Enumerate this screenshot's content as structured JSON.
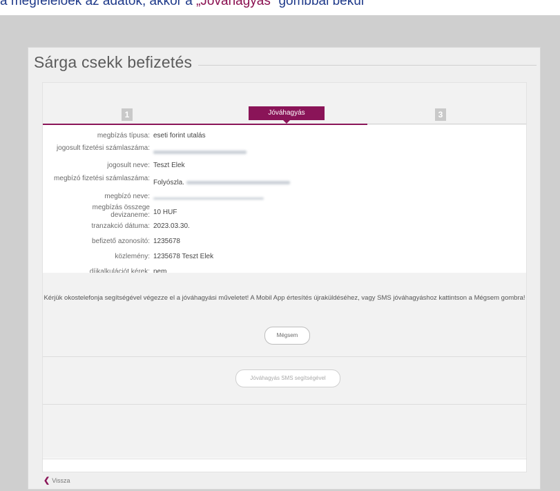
{
  "doc": {
    "pre": "a megfelelőek az adatok, akkor a ",
    "highlight": "„Jóváhagyás”",
    "post": " gombbal bekül"
  },
  "page": {
    "title": "Sárga csekk befizetés"
  },
  "steps": {
    "step1": "1",
    "active": "Jóváhagyás",
    "step3": "3"
  },
  "fields": [
    {
      "label": "megbízás típusa:",
      "value": "eseti forint utalás"
    },
    {
      "label": "jogosult fizetési számlaszáma:",
      "value": ""
    },
    {
      "label": "jogosult neve:",
      "value": "Teszt Elek"
    },
    {
      "label": "megbízó fizetési számlaszáma:",
      "value": "Folyószla."
    },
    {
      "label": "megbízó neve:",
      "value": ""
    },
    {
      "label": "megbízás összege devizaneme:",
      "value": "10 HUF"
    },
    {
      "label": "tranzakció dátuma:",
      "value": "2023.03.30."
    },
    {
      "label": "befizető azonosító:",
      "value": "1235678"
    },
    {
      "label": "közlemény:",
      "value": "1235678 Teszt Elek"
    },
    {
      "label": "díjkalkulációt kérek:",
      "value": "nem"
    }
  ],
  "info": {
    "text": "Kérjük okostelefonja segítségével végezze el a jóváhagyási műveletet! A Mobil App értesítés újraküldéséhez, vagy SMS jóváhagyáshoz kattintson a Mégsem gombra!",
    "cancel_label": "Mégsem",
    "sms_label": "Jóváhagyás SMS segítségével"
  },
  "nav": {
    "back_label": "Vissza"
  },
  "colors": {
    "accent": "#8a1458",
    "doc_text": "#1f3a8a"
  }
}
